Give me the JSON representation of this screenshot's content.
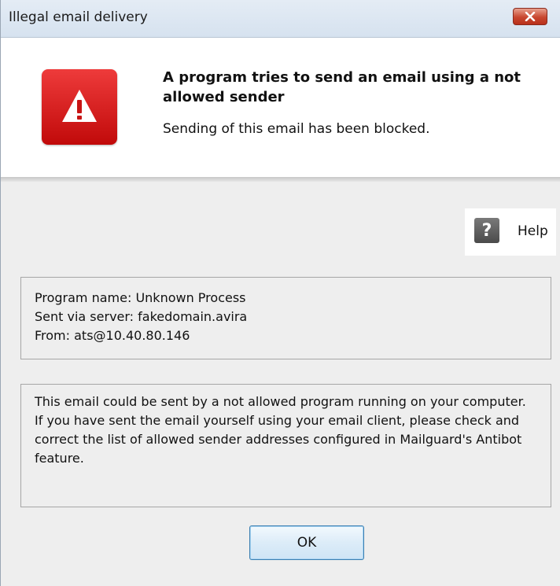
{
  "window": {
    "title": "Illegal email delivery",
    "close_icon": "close-icon"
  },
  "header": {
    "icon": "warning-icon",
    "headline": "A program tries to send an email using a not allowed sender",
    "subline": "Sending of this email has been blocked."
  },
  "help": {
    "icon": "question-icon",
    "icon_glyph": "?",
    "label": "Help"
  },
  "details": {
    "program_name": "Program name: Unknown Process",
    "server": "Sent via server: fakedomain.avira",
    "from": "From: ats@10.40.80.146"
  },
  "message": {
    "line1": "This email could be sent by a not allowed program running on your computer.",
    "line2": "If you have sent the email yourself using your email client, please check and correct the list of allowed sender addresses configured in Mailguard's Antibot feature."
  },
  "buttons": {
    "ok_label": "OK"
  },
  "colors": {
    "warning_red": "#d81b1b",
    "close_red": "#c8472f",
    "button_border": "#3c7fb1"
  }
}
